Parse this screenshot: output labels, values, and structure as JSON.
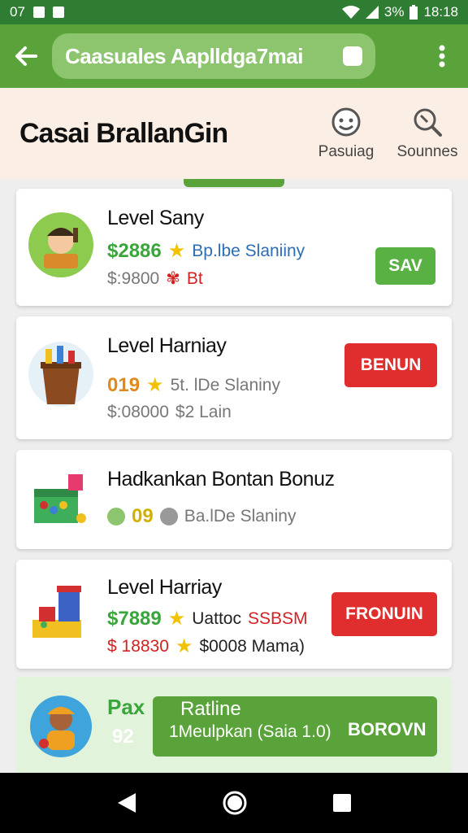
{
  "status_bar": {
    "left_text": "07",
    "battery_text": "3%",
    "time": "18:18"
  },
  "app_bar": {
    "search_text": "Caasuales Aaplldga7mai"
  },
  "header": {
    "title": "Casai BrallanGin",
    "actions": [
      {
        "label": "Pasuiag",
        "icon": "smile-face-icon"
      },
      {
        "label": "Sounnes",
        "icon": "search-icon"
      }
    ]
  },
  "cards": [
    {
      "title": "Level Sany",
      "price": "$2886",
      "rating_text": "Bp.lbe Slaniiny",
      "old_price": "$:9800",
      "tag": "Bt",
      "button": "SAV"
    },
    {
      "title": "Level Harniay",
      "price": "019",
      "rating_text": "5t. lDe Slaniny",
      "old_price": "$:08000",
      "tag": "$2 Lain",
      "button": "BENUN"
    },
    {
      "title": "Hadkankan Bontan Bonuz",
      "price": "09",
      "rating_text": "Ba.lDe Slaniny"
    },
    {
      "title": "Level Harriay",
      "price": "$7889",
      "rating_text": "Uattoc",
      "rating_extra": "SSBSM",
      "old_price": "$ 18830",
      "extra": "$0008 Mama)",
      "button": "FRONUIN"
    }
  ],
  "promo": {
    "label": "Pax",
    "count": "92",
    "title": "Ratline",
    "subtitle": "1Meulpkan (Saia 1.0)",
    "button": "BOROVN"
  },
  "colors": {
    "primary": "#5aa33a",
    "status_bar": "#2e7d32",
    "accent_red": "#e02d2d",
    "header_bg": "#fbeee4"
  }
}
